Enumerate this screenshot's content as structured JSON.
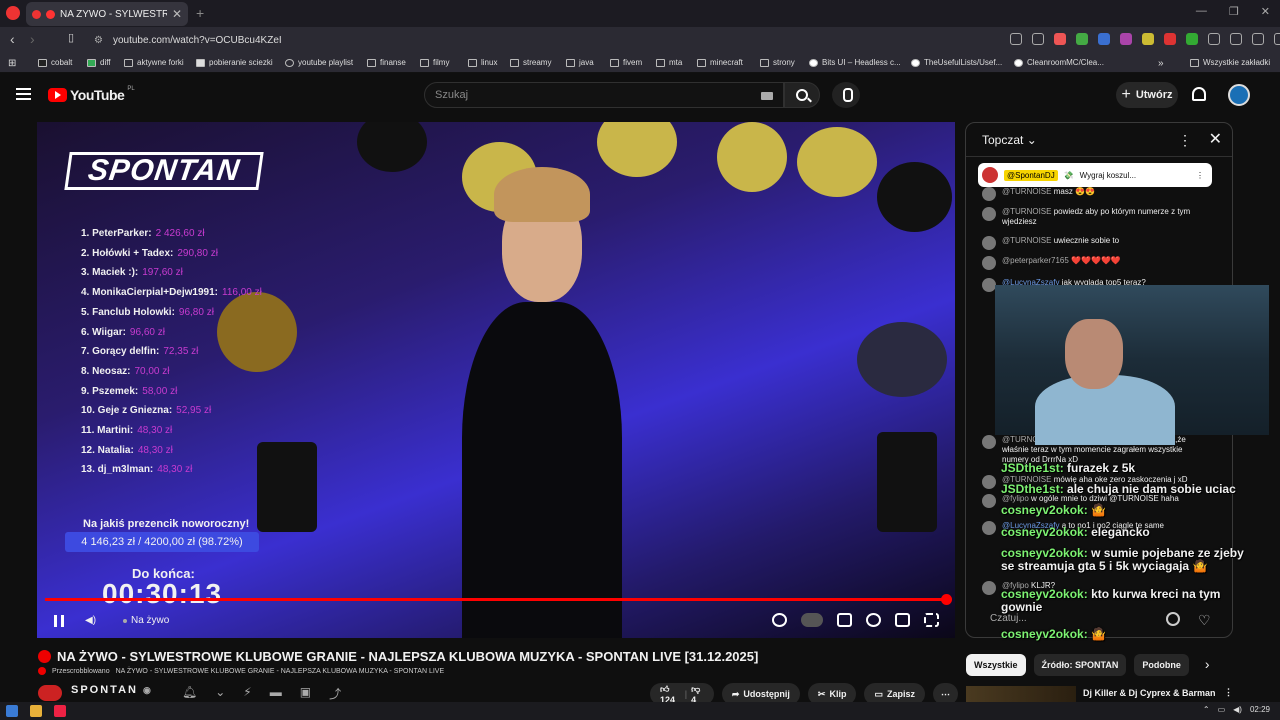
{
  "browser": {
    "tab_title": "NA ŻYWO - SYLWESTROW",
    "url": "youtube.com/watch?v=OCUBcu4KZeI",
    "bookmarks": [
      {
        "label": "cobalt"
      },
      {
        "label": "diff"
      },
      {
        "label": "aktywne forki"
      },
      {
        "label": "pobieranie sciezki"
      },
      {
        "label": "youtube playlist"
      },
      {
        "label": "finanse"
      },
      {
        "label": "filmy"
      },
      {
        "label": "linux"
      },
      {
        "label": "streamy"
      },
      {
        "label": "java"
      },
      {
        "label": "fivem"
      },
      {
        "label": "mta"
      },
      {
        "label": "minecraft"
      },
      {
        "label": "strony"
      },
      {
        "label": "Bits UI – Headless c..."
      },
      {
        "label": "TheUsefulLists/Usef..."
      },
      {
        "label": "CleanroomMC/Clea..."
      },
      {
        "label": "Wszystkie zakładki"
      }
    ]
  },
  "youtube": {
    "logo": "YouTube",
    "region": "PL",
    "search_placeholder": "Szukaj",
    "create_label": "Utwórz"
  },
  "video": {
    "overlay_logo": "SPONTAN",
    "donors": [
      {
        "name": "1. PeterParker:",
        "amount": "2 426,60 zł"
      },
      {
        "name": "2. Hołówki + Tadex:",
        "amount": "290,80 zł"
      },
      {
        "name": "3. Maciek :):",
        "amount": "197,60 zł"
      },
      {
        "name": "4. MonikaCierpial+Dejw1991:",
        "amount": "116,00 zł"
      },
      {
        "name": "5. Fanclub Holowki:",
        "amount": "96,80 zł"
      },
      {
        "name": "6. Wiigar:",
        "amount": "96,60 zł"
      },
      {
        "name": "7. Gorący delfin:",
        "amount": "72,35 zł"
      },
      {
        "name": "8. Neosaz:",
        "amount": "70,00 zł"
      },
      {
        "name": "9. Pszemek:",
        "amount": "58,00 zł"
      },
      {
        "name": "10. Geje z Gniezna:",
        "amount": "52,95 zł"
      },
      {
        "name": "11. Martini:",
        "amount": "48,30 zł"
      },
      {
        "name": "12. Natalia:",
        "amount": "48,30 zł"
      },
      {
        "name": "13. dj_m3lman:",
        "amount": "48,30 zł"
      }
    ],
    "gift_title": "Na jakiś prezencik noworoczny!",
    "gift_progress": "4 146,23 zł / 4200,00 zł (98.72%)",
    "countdown_label": "Do końca:",
    "countdown": "00:30:13",
    "live_label": "Na żywo",
    "title": "NA ŻYWO - SYLWESTROWE KLUBOWE GRANIE - NAJLEPSZA KLUBOWA MUZYKA - SPONTAN LIVE [31.12.2025]",
    "subtitle_prefix": "Przescrobblowano",
    "subtitle": "NA ŻYWO - SYLWESTROWE KLUBOWE GRANIE - NAJLEPSZA KLUBOWA MUZYKA - SPONTAN LIVE",
    "channel": "SPONTAN",
    "likes": "124",
    "dislikes": "4",
    "share": "Udostępnij",
    "clip": "Klip",
    "save": "Zapisz"
  },
  "chat": {
    "header": "Topczat",
    "pinned_user": "@SpontanDJ",
    "pinned_text": "Wygraj koszul...",
    "messages": [
      {
        "author": "@TURNOISE",
        "text": "masz 😍😍"
      },
      {
        "author": "@TURNOISE",
        "text": "powiedz aby po którym numerze z tym wjedziesz"
      },
      {
        "author": "@TURNOISE",
        "text": "uwiecznie sobie to"
      },
      {
        "author": "@peterparker7165",
        "text": "❤️❤️❤️❤️❤️"
      },
      {
        "author": "@LucynaZszafy",
        "text": "jak wygląda top5 teraz?"
      },
      {
        "author": "@TURNOISE",
        "text": "dziś podchodzi do mnie typ i mówi,że właśnie teraz w tym momencie zagrałem wszystkie numery od DrrrNa xD"
      },
      {
        "author": "@TURNOISE",
        "text": "mówię aha oke zero zaskoczenia j xD"
      },
      {
        "author": "@fylipo",
        "text": "w ogóle mnie to dziwi @TURNOISE haha"
      },
      {
        "author": "@LucynaZszafy",
        "text": "a to no1 i no2 ciągle te same"
      },
      {
        "author": "@fylipo",
        "text": "KLJR?"
      }
    ],
    "overlay_messages": [
      {
        "name": "JSDthe1st:",
        "text": "furazek z 5k"
      },
      {
        "name": "JSDthe1st:",
        "text": "ale chuja nie dam sobie uciac"
      },
      {
        "name": "cosneyv2okok:",
        "text": "🤷"
      },
      {
        "name": "cosneyv2okok:",
        "text": "elegancko"
      },
      {
        "name": "cosneyv2okok:",
        "text": "w sumie pojebane ze zjeby se streamuja gta 5 i 5k wyciagaja 🤷"
      },
      {
        "name": "cosneyv2okok:",
        "text": "kto kurwa kreci na tym gownie"
      },
      {
        "name": "cosneyv2okok:",
        "text": "🤷"
      }
    ],
    "input_placeholder": "Czatuj..."
  },
  "sidebar": {
    "chips": [
      "Wszystkie",
      "Źródło: SPONTAN",
      "Podobne"
    ],
    "rec_title": "Dj Killer & Dj Cyprex & Barman"
  },
  "taskbar": {
    "time": "02:29"
  }
}
